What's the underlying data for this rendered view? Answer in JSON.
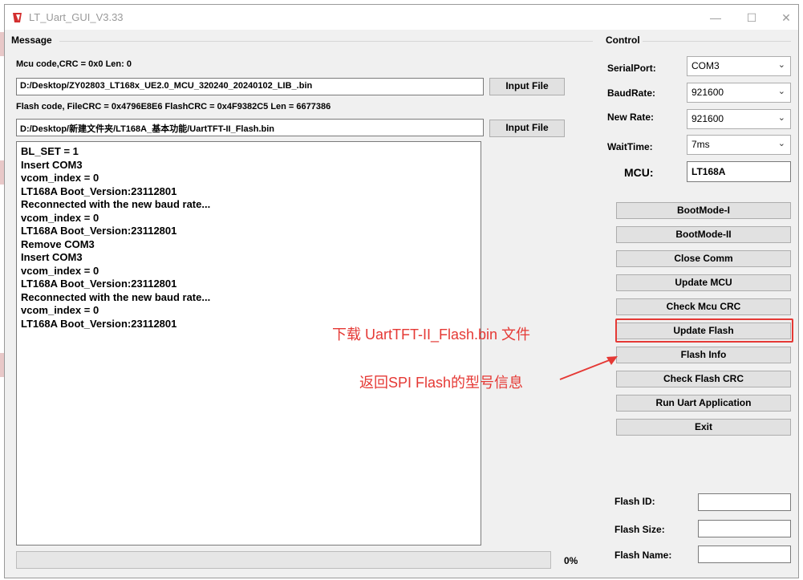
{
  "window": {
    "title": "LT_Uart_GUI_V3.33",
    "minimize_glyph": "—",
    "maximize_glyph": "☐",
    "close_glyph": "✕"
  },
  "message": {
    "group_label": "Message",
    "mcu_info": "Mcu code,CRC = 0x0  Len: 0",
    "mcu_path": "D:/Desktop/ZY02803_LT168x_UE2.0_MCU_320240_20240102_LIB_.bin",
    "input_file_label": "Input File",
    "flash_info": "Flash code, FileCRC = 0x4796E8E6  FlashCRC = 0x4F9382C5  Len = 6677386",
    "flash_path": "D:/Desktop/新建文件夹/LT168A_基本功能/UartTFT-II_Flash.bin",
    "log": [
      "BL_SET = 1",
      "Insert COM3",
      "vcom_index = 0",
      "LT168A Boot_Version:23112801",
      "Reconnected with the new baud rate...",
      "vcom_index = 0",
      "LT168A Boot_Version:23112801",
      "Remove COM3",
      "Insert COM3",
      "vcom_index = 0",
      "LT168A Boot_Version:23112801",
      "Reconnected with the new baud rate...",
      "vcom_index = 0",
      "LT168A Boot_Version:23112801"
    ],
    "progress_percent": 0,
    "progress_label": "0%"
  },
  "control": {
    "group_label": "Control",
    "serial_port_label": "SerialPort:",
    "serial_port_value": "COM3",
    "baud_rate_label": "BaudRate:",
    "baud_rate_value": "921600",
    "new_rate_label": "New Rate:",
    "new_rate_value": "921600",
    "wait_time_label": "WaitTime:",
    "wait_time_value": "7ms",
    "mcu_label": "MCU:",
    "mcu_value": "LT168A",
    "buttons": [
      "BootMode-I",
      "BootMode-II",
      "Close Comm",
      "Update MCU",
      "Check Mcu CRC",
      "Update Flash",
      "Flash Info",
      "Check Flash CRC",
      "Run Uart Application",
      "Exit"
    ],
    "flash_id_label": "Flash ID:",
    "flash_id_value": "",
    "flash_size_label": "Flash Size:",
    "flash_size_value": "",
    "flash_name_label": "Flash Name:",
    "flash_name_value": ""
  },
  "annotations": {
    "download_note": "下载 UartTFT-II_Flash.bin 文件",
    "flash_info_note": "返回SPI Flash的型号信息",
    "color": "#e53935"
  }
}
